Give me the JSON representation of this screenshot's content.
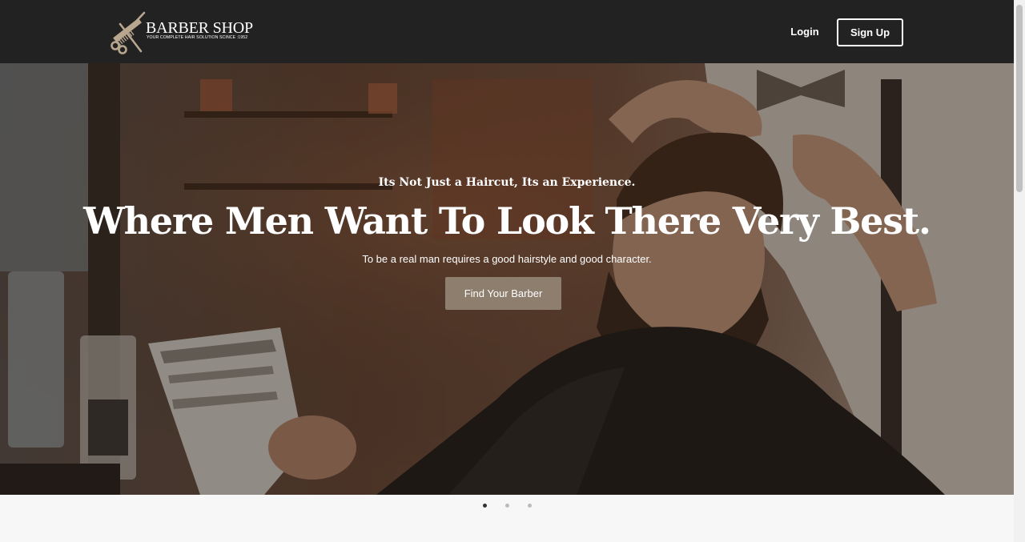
{
  "brand": {
    "name": "BARBER SHOP",
    "tagline": "YOUR COMPLETE HAIR SOLUTION SCINCE :1952",
    "logo_icon": "scissors-comb-icon"
  },
  "nav": {
    "login_label": "Login",
    "signup_label": "Sign Up"
  },
  "hero": {
    "kicker": "Its Not Just a Haircut, Its an Experience.",
    "headline": "Where Men Want To Look There Very Best.",
    "subline": "To be a real man requires a good hairstyle and good character.",
    "cta_label": "Find Your Barber",
    "background_image": "barber-cutting-bearded-man-photo"
  },
  "carousel": {
    "slide_count": 3,
    "active_index": 0
  },
  "colors": {
    "header_bg": "#232222",
    "cta_bg": "#8e7e6e",
    "dot_active": "#333333",
    "dot_inactive": "#bbbbbb",
    "page_bg": "#f7f7f8"
  }
}
